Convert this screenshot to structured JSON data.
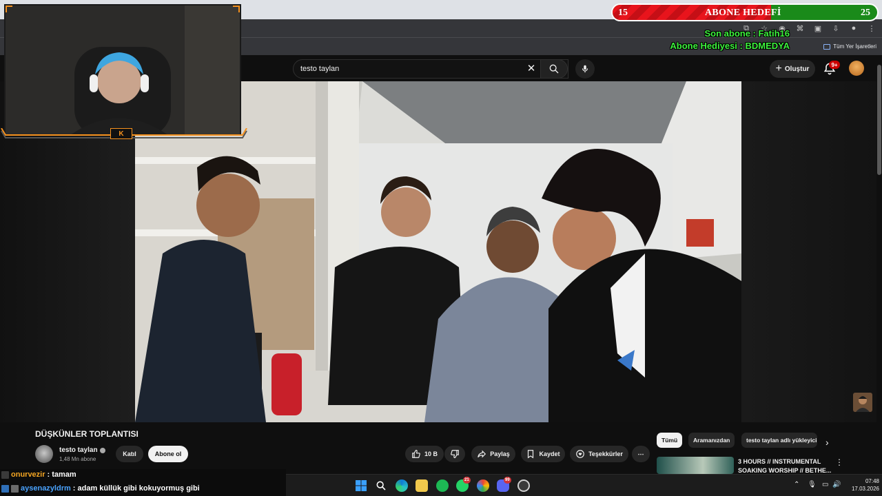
{
  "search": {
    "query": "testo taylan"
  },
  "header": {
    "create_label": "Oluştur",
    "notifications_count": "9+"
  },
  "bookmarks": {
    "all_label": "Tüm Yer İşaretleri"
  },
  "overlay": {
    "goal_current": "15",
    "goal_title": "ABONE HEDEFİ",
    "goal_target": "25",
    "goal_progress": 0.6,
    "last_sub": "Son abone : Fatih16",
    "gift_sub": "Abone Hediyesi : BDMEDYA",
    "cam_logo": "K"
  },
  "video": {
    "title": "DÜŞKÜNLER TOPLANTISI",
    "channel_name": "testo taylan",
    "channel_subs": "1,48 Mn abone",
    "join_label": "Katıl",
    "subscribe_label": "Abone ol",
    "likes": "10 B",
    "share_label": "Paylaş",
    "save_label": "Kaydet",
    "thanks_label": "Teşekkürler",
    "more_label": "⋯"
  },
  "chips": [
    "Tümü",
    "Aramanızdan",
    "testo taylan adlı yükleyici"
  ],
  "recommendation": {
    "title": "3 HOURS // INSTRUMENTAL SOAKING WORSHIP // BETHE..."
  },
  "chat": [
    {
      "user": "onurvezir",
      "message": ": tamam",
      "color": "#f5a623"
    },
    {
      "user": "aysenazyldrm",
      "message": ": adam küllük gibi kokuyormuş gibi",
      "color": "#4aa3ff"
    }
  ],
  "taskbar": {
    "whatsapp_badge": "21",
    "discord_badge": "99",
    "time": "07:48",
    "date": "17.03.2026"
  },
  "colors": {
    "accent_red": "#cc0000",
    "goal_green": "#3df33d",
    "cam_orange": "#f7921e"
  }
}
